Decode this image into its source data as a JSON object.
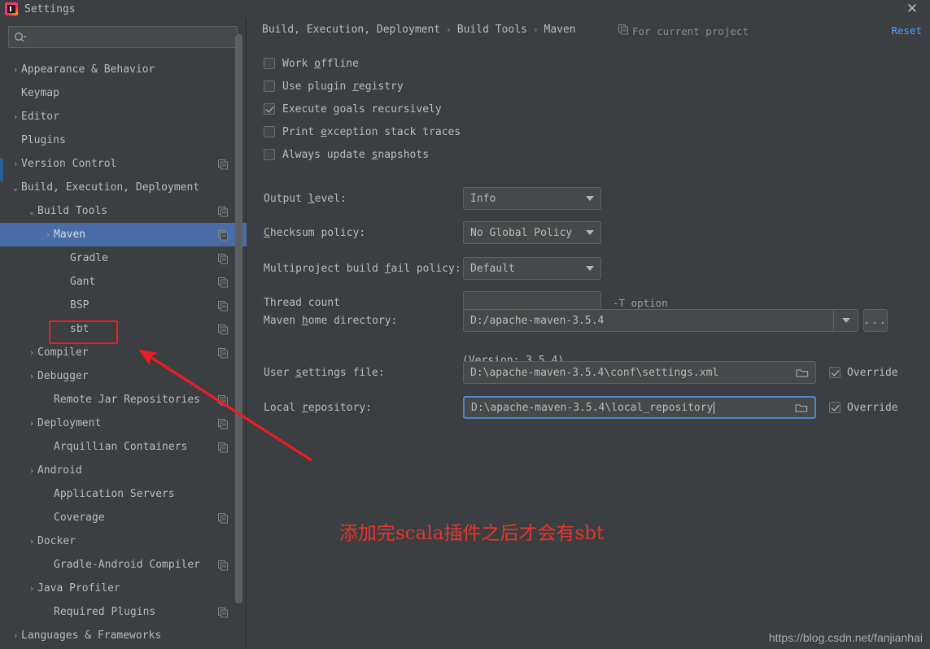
{
  "window": {
    "title": "Settings",
    "logo_icon": "intellij-idea-logo",
    "close_icon": "close-icon"
  },
  "sidebar": {
    "search": {
      "placeholder": "",
      "value": "",
      "icon": "search-icon"
    },
    "items": [
      {
        "label": "Appearance & Behavior",
        "indent": 0,
        "arrow": "›",
        "copy": false,
        "selected": false
      },
      {
        "label": "Keymap",
        "indent": 0,
        "arrow": "",
        "copy": false,
        "selected": false
      },
      {
        "label": "Editor",
        "indent": 0,
        "arrow": "›",
        "copy": false,
        "selected": false
      },
      {
        "label": "Plugins",
        "indent": 0,
        "arrow": "",
        "copy": false,
        "selected": false
      },
      {
        "label": "Version Control",
        "indent": 0,
        "arrow": "›",
        "copy": true,
        "selected": false
      },
      {
        "label": "Build, Execution, Deployment",
        "indent": 0,
        "arrow": "⌄",
        "copy": false,
        "selected": false
      },
      {
        "label": "Build Tools",
        "indent": 1,
        "arrow": "⌄",
        "copy": true,
        "selected": false
      },
      {
        "label": "Maven",
        "indent": 2,
        "arrow": "›",
        "copy": true,
        "selected": true
      },
      {
        "label": "Gradle",
        "indent": 3,
        "arrow": "",
        "copy": true,
        "selected": false
      },
      {
        "label": "Gant",
        "indent": 3,
        "arrow": "",
        "copy": true,
        "selected": false
      },
      {
        "label": "BSP",
        "indent": 3,
        "arrow": "",
        "copy": true,
        "selected": false
      },
      {
        "label": "sbt",
        "indent": 3,
        "arrow": "",
        "copy": true,
        "selected": false
      },
      {
        "label": "Compiler",
        "indent": 1,
        "arrow": "›",
        "copy": true,
        "selected": false
      },
      {
        "label": "Debugger",
        "indent": 1,
        "arrow": "›",
        "copy": false,
        "selected": false
      },
      {
        "label": "Remote Jar Repositories",
        "indent": 2,
        "arrow": "",
        "copy": true,
        "selected": false
      },
      {
        "label": "Deployment",
        "indent": 1,
        "arrow": "›",
        "copy": true,
        "selected": false
      },
      {
        "label": "Arquillian Containers",
        "indent": 2,
        "arrow": "",
        "copy": true,
        "selected": false
      },
      {
        "label": "Android",
        "indent": 1,
        "arrow": "›",
        "copy": false,
        "selected": false
      },
      {
        "label": "Application Servers",
        "indent": 2,
        "arrow": "",
        "copy": false,
        "selected": false
      },
      {
        "label": "Coverage",
        "indent": 2,
        "arrow": "",
        "copy": true,
        "selected": false
      },
      {
        "label": "Docker",
        "indent": 1,
        "arrow": "›",
        "copy": false,
        "selected": false
      },
      {
        "label": "Gradle-Android Compiler",
        "indent": 2,
        "arrow": "",
        "copy": true,
        "selected": false
      },
      {
        "label": "Java Profiler",
        "indent": 1,
        "arrow": "›",
        "copy": false,
        "selected": false
      },
      {
        "label": "Required Plugins",
        "indent": 2,
        "arrow": "",
        "copy": true,
        "selected": false
      },
      {
        "label": "Languages & Frameworks",
        "indent": 0,
        "arrow": "›",
        "copy": false,
        "selected": false
      }
    ]
  },
  "main": {
    "breadcrumb": [
      "Build, Execution, Deployment",
      "Build Tools",
      "Maven"
    ],
    "breadcrumb_separator": "›",
    "for_current_project": "For current project",
    "for_current_project_icon": "project-scope-icon",
    "reset_label": "Reset",
    "checkboxes": [
      {
        "label_pre": "Work ",
        "mnemonic": "o",
        "label_post": "ffline",
        "checked": false
      },
      {
        "label_pre": "Use plugin ",
        "mnemonic": "r",
        "label_post": "egistry",
        "checked": false
      },
      {
        "label_pre": "Execute ",
        "mnemonic": "g",
        "label_post": "oals recursively",
        "checked": true
      },
      {
        "label_pre": "Print ",
        "mnemonic": "e",
        "label_post": "xception stack traces",
        "checked": false
      },
      {
        "label_pre": "Always update ",
        "mnemonic": "s",
        "label_post": "napshots",
        "checked": false
      }
    ],
    "output_level": {
      "label_pre": "Output ",
      "mnemonic": "l",
      "label_post": "evel:",
      "value": "Info"
    },
    "checksum_policy": {
      "label_pre": "",
      "mnemonic": "C",
      "label_post": "hecksum policy:",
      "value": "No Global Policy"
    },
    "fail_policy": {
      "label_pre": "Multiproject build ",
      "mnemonic": "f",
      "label_post": "ail policy:",
      "value": "Default"
    },
    "thread_count": {
      "label": "Thread count",
      "value": "",
      "hint": "-T option"
    },
    "maven_home": {
      "label_pre": "Maven ",
      "mnemonic": "h",
      "label_post": "ome directory:",
      "value": "D:/apache-maven-3.5.4",
      "browse_label": "...",
      "version_note": "(Version: 3.5.4)"
    },
    "user_settings": {
      "label_pre": "User ",
      "mnemonic": "s",
      "label_post": "ettings file:",
      "value": "D:\\apache-maven-3.5.4\\conf\\settings.xml",
      "override_label": "Override",
      "override_checked": true,
      "folder_icon": "folder-icon"
    },
    "local_repository": {
      "label_pre": "Local ",
      "mnemonic": "r",
      "label_post": "epository:",
      "value": "D:\\apache-maven-3.5.4\\local_repository",
      "override_label": "Override",
      "override_checked": true,
      "folder_icon": "folder-icon",
      "focused": true
    }
  },
  "annotations": {
    "highlight_target": "sbt",
    "note_text": "添加完scala插件之后才会有sbt",
    "color": "#ee1c25",
    "arrow_icon": "arrow-pointer-icon"
  },
  "watermark": {
    "text": "https://blog.csdn.net/fanjianhai"
  },
  "colors": {
    "background": "#3c3f41",
    "sidebar": "#3b3f42",
    "selection": "#4a6da7",
    "link": "#589df6",
    "annotation_red": "#ee1c25",
    "focus_border": "#4a88c7"
  }
}
